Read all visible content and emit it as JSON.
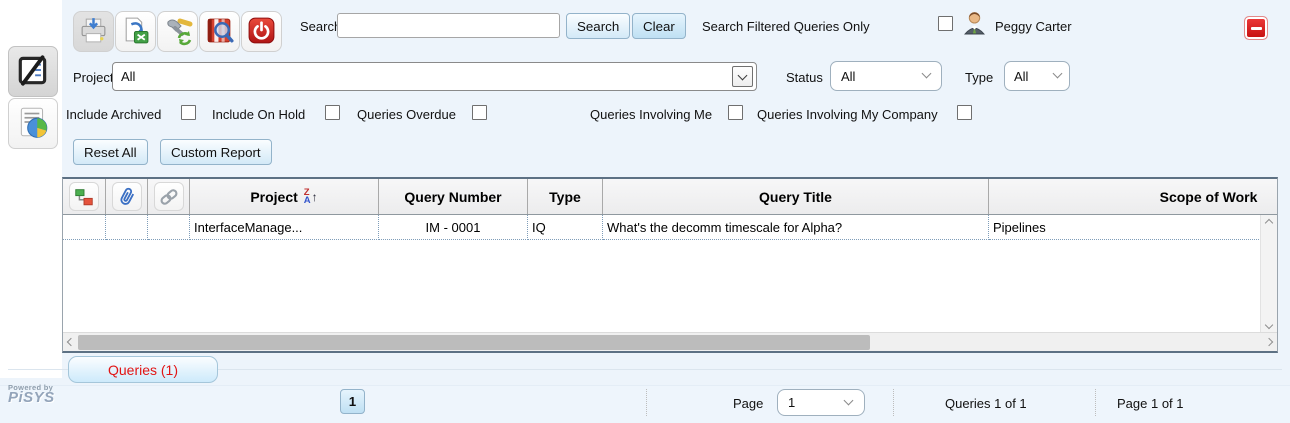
{
  "header": {
    "search_label": "Search",
    "search_value": "",
    "search_button": "Search",
    "clear_button": "Clear",
    "filtered_only_label": "Search Filtered Queries Only",
    "user_name": "Peggy Carter"
  },
  "filters": {
    "project_label": "Project",
    "project_value": "All",
    "status_label": "Status",
    "status_value": "All",
    "type_label": "Type",
    "type_value": "All",
    "checkboxes": [
      {
        "label": "Include Archived",
        "checked": false
      },
      {
        "label": "Include On Hold",
        "checked": false
      },
      {
        "label": "Queries Overdue",
        "checked": false
      },
      {
        "label": "Queries Involving Me",
        "checked": false
      },
      {
        "label": "Queries Involving My Company",
        "checked": false
      }
    ],
    "reset_button": "Reset All",
    "custom_report_button": "Custom Report"
  },
  "table": {
    "columns": [
      "Project",
      "Query Number",
      "Type",
      "Query Title",
      "Scope of Work"
    ],
    "sort_icon": {
      "top": "Z",
      "bottom": "A",
      "arrow": "↑"
    },
    "rows": [
      {
        "project": "InterfaceManage...",
        "query_number": "IM - 0001",
        "type": "IQ",
        "query_title": "What's the decomm timescale for Alpha?",
        "scope_of_work": "Pipelines"
      }
    ]
  },
  "tabs": [
    {
      "label": "Queries (1)",
      "count": 1
    }
  ],
  "pagination": {
    "page_button": "1",
    "page_label": "Page",
    "page_value": "1",
    "queries_summary": "Queries 1 of 1",
    "page_summary": "Page 1 of 1"
  },
  "branding": {
    "powered_by": "Powered by",
    "logo": "PiSYS"
  },
  "icons": [
    "notepad-pen-icon",
    "report-pie-icon",
    "printer-icon",
    "export-excel-icon",
    "tools-refresh-icon",
    "book-magnifier-icon",
    "power-icon",
    "user-icon",
    "collapse-minus-icon",
    "hierarchy-icon",
    "paperclip-icon",
    "link-icon",
    "sort-ascending-icon"
  ],
  "colors": {
    "panel_bg": "#edf4fb",
    "button_blue": "#cfe7f7",
    "tab_text_red": "#e21414",
    "danger_red": "#d21f1f",
    "grid_border": "#5d7184",
    "dotted_cell": "#7f9db9"
  }
}
